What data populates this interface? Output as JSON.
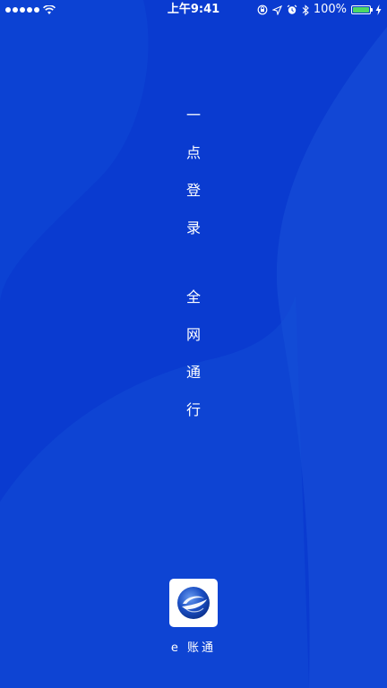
{
  "status_bar": {
    "carrier_signal": "●●●●●",
    "time": "上午9:41",
    "battery_percent": "100%",
    "battery_level": 1.0,
    "icons": [
      "signal-dots",
      "wifi-icon",
      "orientation-lock-icon",
      "location-icon",
      "alarm-icon",
      "bluetooth-icon",
      "battery-icon",
      "charging-icon"
    ]
  },
  "slogan": {
    "line1": [
      "一",
      "点",
      "登",
      "录"
    ],
    "line2": [
      "全",
      "网",
      "通",
      "行"
    ]
  },
  "app": {
    "name": "e 账通",
    "logo_icon": "e-globe-logo-icon"
  },
  "colors": {
    "background": "#0a3bd0",
    "background_light": "#1a4fd6",
    "battery_fill": "#4cd964",
    "text": "#ffffff"
  }
}
